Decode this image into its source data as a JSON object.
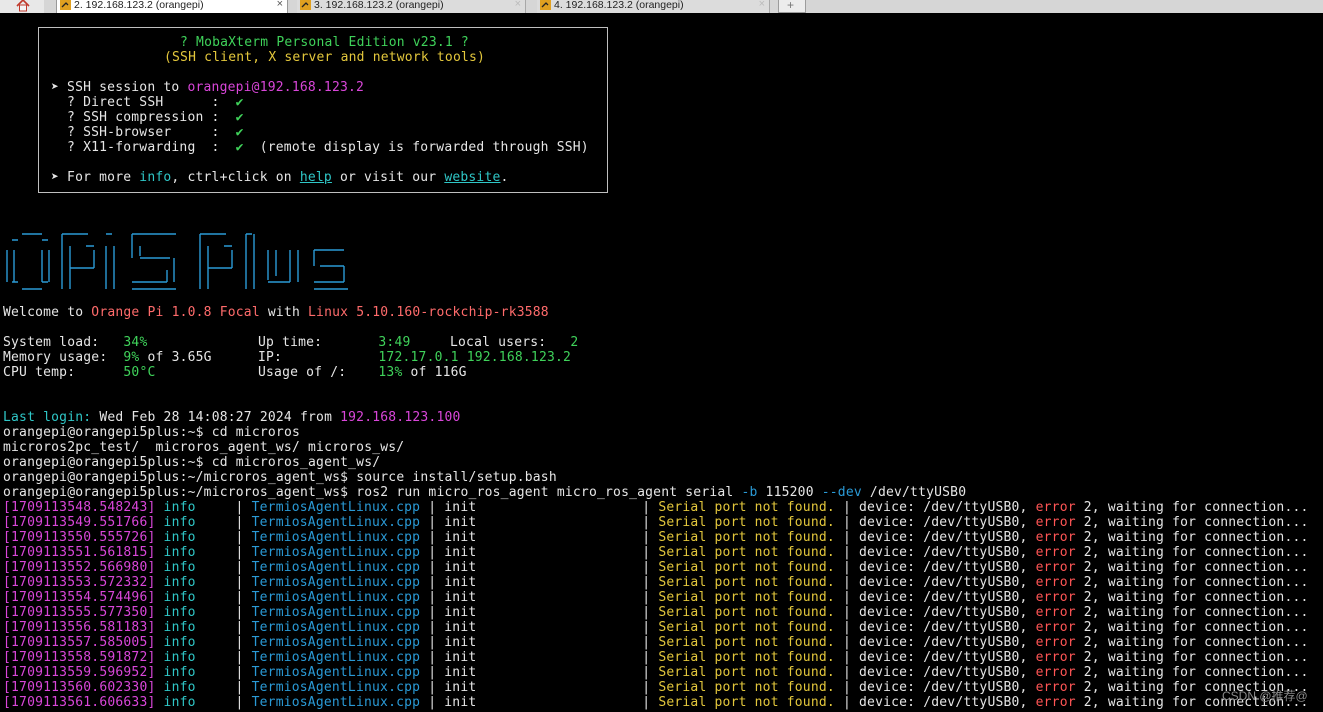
{
  "tabs": [
    {
      "label": "2. 192.168.123.2 (orangepi)",
      "active": true,
      "close": "×"
    },
    {
      "label": "3. 192.168.123.2 (orangepi)",
      "active": false,
      "close": "×"
    },
    {
      "label": "4. 192.168.123.2 (orangepi)",
      "active": false,
      "close": "×"
    }
  ],
  "newtab_icon": "+",
  "banner": {
    "title": "? MobaXterm Personal Edition v23.1 ?",
    "subtitle": "(SSH client, X server and network tools)",
    "session_prefix": "➤ SSH session to ",
    "session_host": "orangepi@192.168.123.2",
    "items": [
      {
        "label": "  ? Direct SSH      :  ",
        "check": "✔",
        "note": ""
      },
      {
        "label": "  ? SSH compression :  ",
        "check": "✔",
        "note": ""
      },
      {
        "label": "  ? SSH-browser     :  ",
        "check": "✔",
        "note": ""
      },
      {
        "label": "  ? X11-forwarding  :  ",
        "check": "✔",
        "note": "  (remote display is forwarded through SSH)"
      }
    ],
    "more_prefix": "➤ For more ",
    "more_info": "info",
    "more_mid": ", ctrl+click on ",
    "more_help": "help",
    "more_mid2": " or visit our ",
    "more_website": "website",
    "more_end": "."
  },
  "logo_text": "opi5plus",
  "welcome": {
    "prefix": "Welcome to ",
    "os": "Orange Pi 1.0.8 Focal",
    "mid": " with ",
    "kernel": "Linux 5.10.160-rockchip-rk3588"
  },
  "stats": {
    "sysload_label": "System load:   ",
    "sysload": "34%",
    "uptime_label": "Up time:       ",
    "uptime": "3:49",
    "users_label": "Local users:   ",
    "users": "2",
    "mem_label": "Memory usage:  ",
    "mem_pct": "9%",
    "mem_rest": " of 3.65G",
    "ip_label": "IP:            ",
    "ip": "172.17.0.1 192.168.123.2",
    "cpu_label": "CPU temp:      ",
    "cpu": "50°C",
    "usage_label": "Usage of /:    ",
    "usage_pct": "13%",
    "usage_rest": " of 116G"
  },
  "last_login": {
    "label": "Last login:",
    "date": " Wed Feb 28 14:08:27 2024 from ",
    "host": "192.168.123.100"
  },
  "commands": [
    {
      "prompt": "orangepi@orangepi5plus:~$ ",
      "cmd": "cd microros"
    },
    {
      "prompt": "",
      "cmd": "microros2pc_test/  microros_agent_ws/ microros_ws/"
    },
    {
      "prompt": "orangepi@orangepi5plus:~$ ",
      "cmd": "cd microros_agent_ws/"
    },
    {
      "prompt": "orangepi@orangepi5plus:~/microros_agent_ws$ ",
      "cmd": "source install/setup.bash"
    }
  ],
  "run_cmd": {
    "prompt": "orangepi@orangepi5plus:~/microros_agent_ws$ ",
    "part1": "ros2 run micro_ros_agent micro_ros_agent serial ",
    "flag_b": "-b",
    "baud": " 115200 ",
    "flag_dev": "--dev",
    "dev": " /dev/ttyUSB0"
  },
  "log_common": {
    "level": "info",
    "file": "TermiosAgentLinux.cpp",
    "func": "init",
    "msg": "Serial port not found.",
    "device": "device: /dev/ttyUSB0, ",
    "err": "error",
    "tail": " 2, waiting for connection..."
  },
  "log_timestamps": [
    "[1709113548.548243]",
    "[1709113549.551766]",
    "[1709113550.555726]",
    "[1709113551.561815]",
    "[1709113552.566980]",
    "[1709113553.572332]",
    "[1709113554.574496]",
    "[1709113555.577350]",
    "[1709113556.581183]",
    "[1709113557.585005]",
    "[1709113558.591872]",
    "[1709113559.596952]",
    "[1709113560.602330]",
    "[1709113561.606633]"
  ],
  "watermark": "CSDN @推荐@"
}
